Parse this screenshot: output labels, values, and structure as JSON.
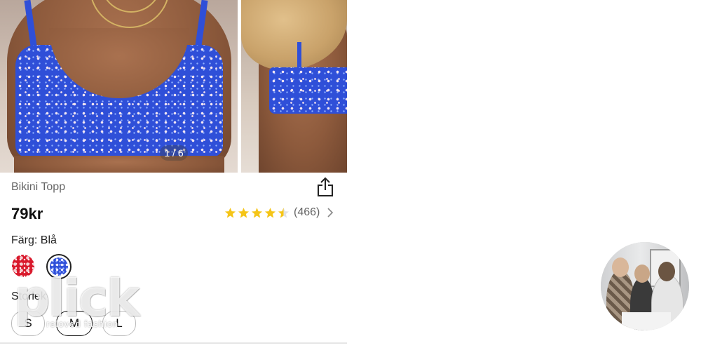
{
  "gallery": {
    "counter": "1 / 6"
  },
  "product": {
    "title": "Bikini Topp",
    "price": "79kr",
    "rating": {
      "stars": 4.5,
      "count": "(466)"
    },
    "color": {
      "label": "Färg: Blå",
      "swatches": [
        "red-floral",
        "blue-floral"
      ],
      "selected": "blue-floral"
    },
    "size": {
      "label": "Storlek",
      "options": [
        "S",
        "M",
        "L"
      ],
      "selected": "M"
    }
  },
  "watermark": {
    "logo": "plick",
    "tagline": "reloved fashion"
  },
  "icons": {
    "share": "share-icon",
    "star": "star-icon",
    "chevron": "chevron-right-icon"
  },
  "colors": {
    "star": "#f5c518",
    "text_muted": "#666666",
    "price": "#111111"
  }
}
